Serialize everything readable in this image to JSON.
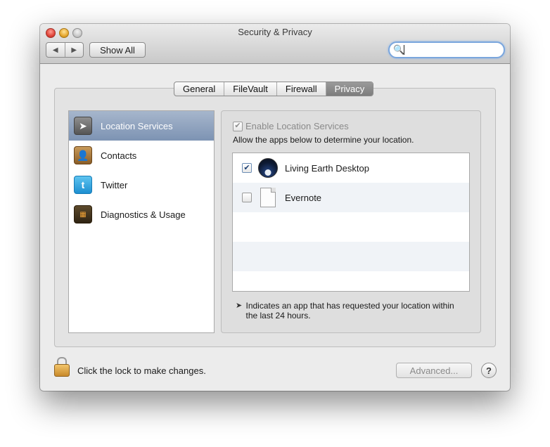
{
  "window": {
    "title": "Security & Privacy"
  },
  "toolbar": {
    "back_icon": "◀",
    "forward_icon": "▶",
    "show_all_label": "Show All",
    "search_icon": "🔍",
    "search_value": ""
  },
  "tabs": [
    {
      "label": "General",
      "active": false
    },
    {
      "label": "FileVault",
      "active": false
    },
    {
      "label": "Firewall",
      "active": false
    },
    {
      "label": "Privacy",
      "active": true
    }
  ],
  "sidebar": {
    "items": [
      {
        "label": "Location Services",
        "icon": "location-arrow-icon",
        "glyph": "➤",
        "selected": true
      },
      {
        "label": "Contacts",
        "icon": "contacts-book-icon",
        "glyph": "👤",
        "selected": false
      },
      {
        "label": "Twitter",
        "icon": "twitter-bird-icon",
        "glyph": "t",
        "selected": false
      },
      {
        "label": "Diagnostics & Usage",
        "icon": "diagnostics-grid-icon",
        "glyph": "▦",
        "selected": false
      }
    ]
  },
  "location": {
    "enable_label": "Enable Location Services",
    "enable_checked": true,
    "description": "Allow the apps below to determine your location.",
    "apps": [
      {
        "name": "Living Earth Desktop",
        "checked": true,
        "icon": "living-earth-icon"
      },
      {
        "name": "Evernote",
        "checked": false,
        "icon": "document-icon"
      }
    ],
    "note_glyph": "➤",
    "note": "Indicates an app that has requested your location within the last 24 hours."
  },
  "footer": {
    "lock_text": "Click the lock to make changes.",
    "advanced_label": "Advanced...",
    "help_label": "?"
  },
  "colors": {
    "selection_blue": "#7d93b3",
    "window_bg": "#ececec",
    "focus_ring": "#7aa6dd"
  }
}
